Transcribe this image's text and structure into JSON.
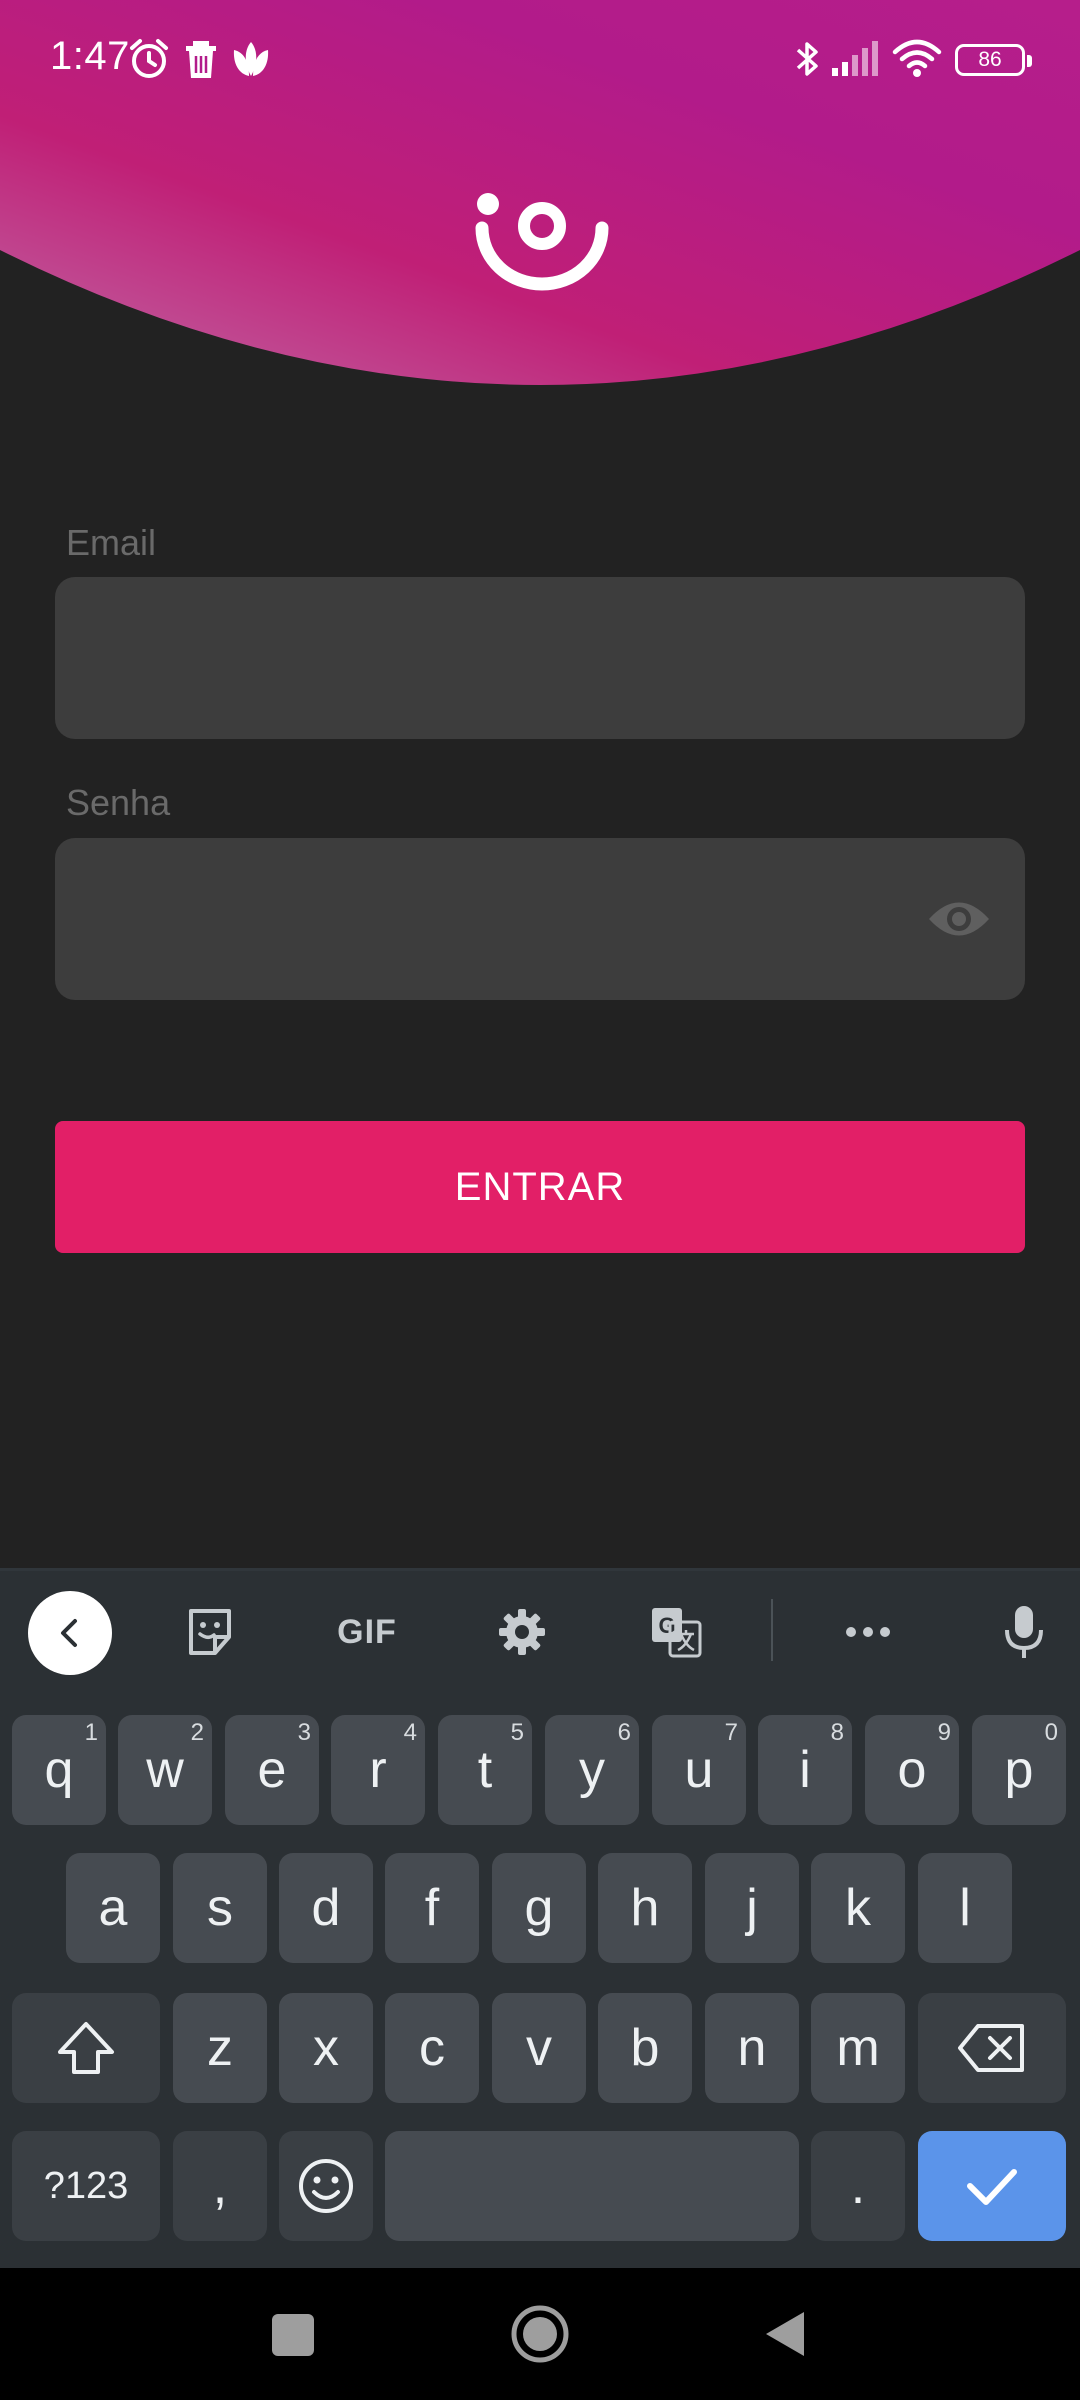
{
  "status_bar": {
    "time": "1:47",
    "left_icons": [
      "alarm-icon",
      "delete-icon",
      "lotus-icon"
    ],
    "right_icons": [
      "bluetooth-icon",
      "signal-icon",
      "wifi-icon"
    ],
    "battery": "86"
  },
  "colors": {
    "header_gradient": [
      "#c06aa6",
      "#b21b8a",
      "#c01f76"
    ],
    "background": "#222222",
    "field": "#3d3d3d",
    "primary_button": "#e21f67",
    "keyboard_bg": "#2b3034",
    "key": "#464b51",
    "enter_key": "#5b94ea"
  },
  "form": {
    "email_label": "Email",
    "email_value": "",
    "password_label": "Senha",
    "password_value": "",
    "password_toggle_icon": "eye-icon",
    "submit_label": "ENTRAR"
  },
  "keyboard": {
    "toolbar": {
      "back_icon": "chevron-left-icon",
      "items": [
        "sticker-icon",
        "GIF",
        "gear-icon",
        "translate-icon",
        "more-icon",
        "microphone-icon"
      ]
    },
    "row1": [
      {
        "k": "q",
        "h": "1"
      },
      {
        "k": "w",
        "h": "2"
      },
      {
        "k": "e",
        "h": "3"
      },
      {
        "k": "r",
        "h": "4"
      },
      {
        "k": "t",
        "h": "5"
      },
      {
        "k": "y",
        "h": "6"
      },
      {
        "k": "u",
        "h": "7"
      },
      {
        "k": "i",
        "h": "8"
      },
      {
        "k": "o",
        "h": "9"
      },
      {
        "k": "p",
        "h": "0"
      }
    ],
    "row2": [
      "a",
      "s",
      "d",
      "f",
      "g",
      "h",
      "j",
      "k",
      "l"
    ],
    "row3": [
      "z",
      "x",
      "c",
      "v",
      "b",
      "n",
      "m"
    ],
    "row4": {
      "symbols": "?123",
      "comma": ",",
      "period": "."
    }
  },
  "nav_bar": {
    "icons": [
      "recents-icon",
      "home-icon",
      "back-icon"
    ]
  }
}
